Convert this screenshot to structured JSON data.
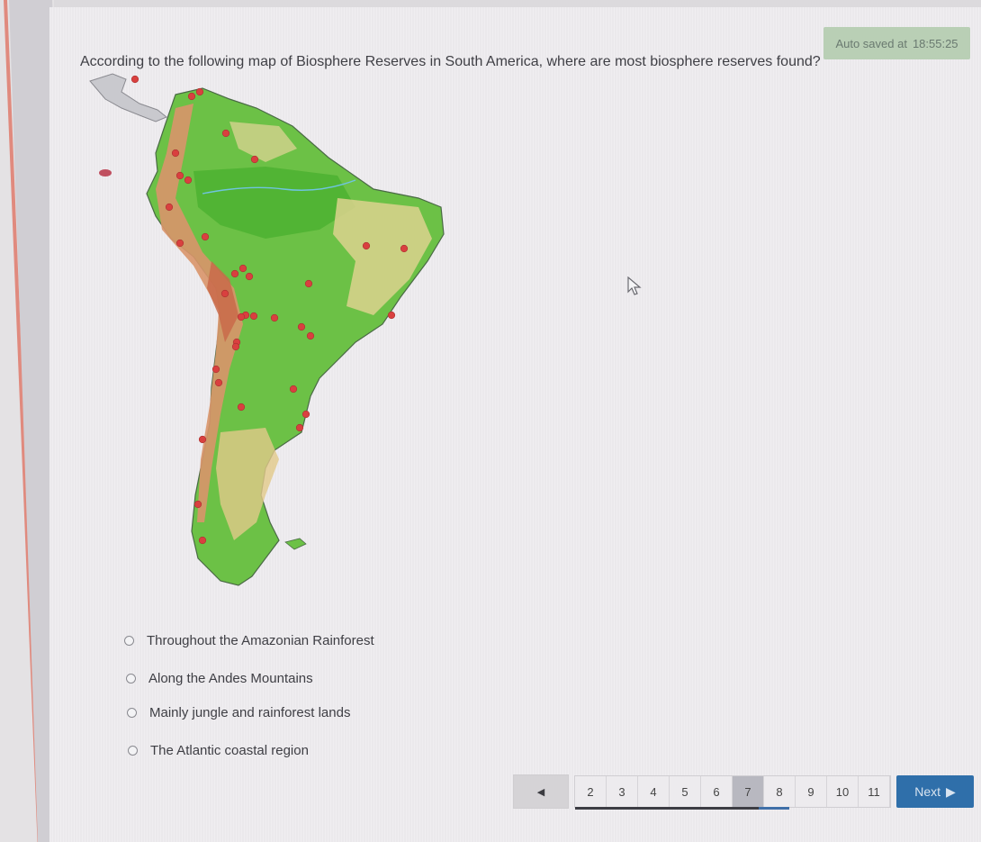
{
  "autosave": {
    "label": "Auto saved at",
    "time": "18:55:25"
  },
  "question": {
    "text": "According to the following map of Biosphere Reserves in South America, where are most biosphere reserves found?"
  },
  "map": {
    "subject": "Biosphere Reserves in South America",
    "marker_color": "#d9403f",
    "land_colors": [
      "#52b838",
      "#8fcc55",
      "#e8d9a0",
      "#d98a5a"
    ]
  },
  "answers": [
    {
      "label": "Throughout the Amazonian Rainforest",
      "selected": false
    },
    {
      "label": "Along the Andes Mountains",
      "selected": false
    },
    {
      "label": "Mainly jungle and rainforest lands",
      "selected": false
    },
    {
      "label": "The Atlantic coastal region",
      "selected": false
    }
  ],
  "pagination": {
    "prev_icon": "◀",
    "pages": [
      "2",
      "3",
      "4",
      "5",
      "6",
      "7",
      "8",
      "9",
      "10",
      "11"
    ],
    "current": "7",
    "progress_fraction": 0.6,
    "next_label": "Next",
    "next_icon": "▶"
  },
  "colors": {
    "next_button": "#2f6faa",
    "autosave_bg": "#b9cfb5",
    "current_page_bg": "#b8b8c0"
  }
}
